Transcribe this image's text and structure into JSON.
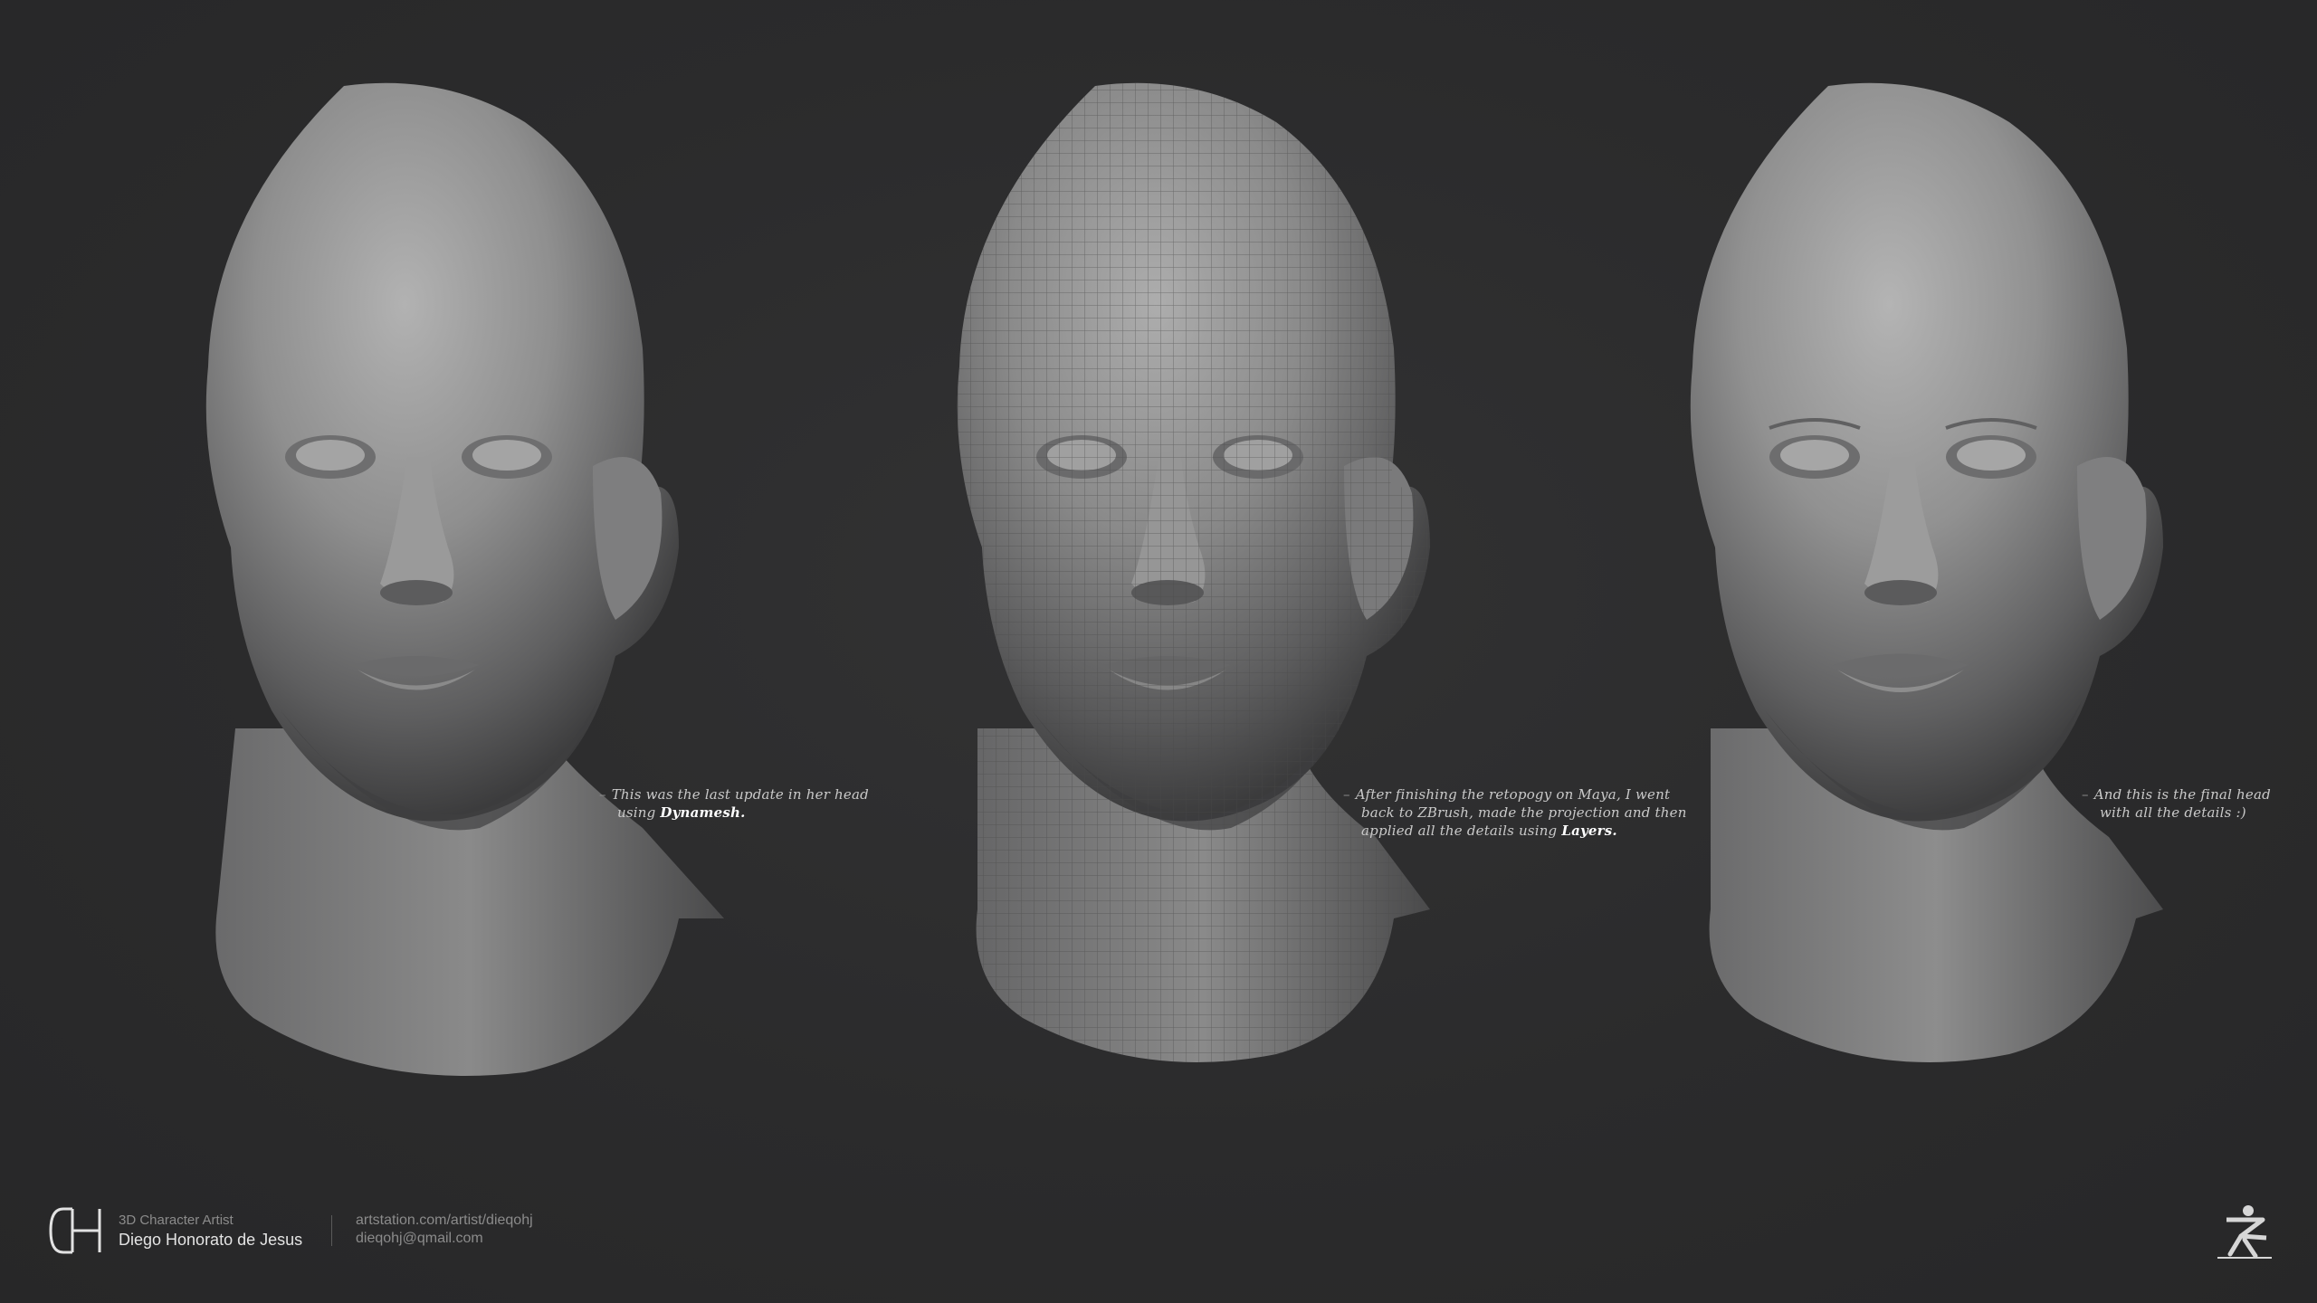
{
  "annotations": {
    "left": {
      "line1": "This was the last update in her head",
      "line2_prefix": "using ",
      "line2_emphasis": "Dynamesh."
    },
    "center": {
      "line1": "After finishing the retopogy on Maya, I went",
      "line2": "back to ZBrush, made the projection and then",
      "line3_prefix": "applied all the details using ",
      "line3_emphasis": "Layers."
    },
    "right": {
      "line1": "And this is the final head",
      "line2": "with all the details :)"
    }
  },
  "footer": {
    "role": "3D Character Artist",
    "name": "Diego Honorato de Jesus",
    "url": "artstation.com/artist/dieqohj",
    "email": "dieqohj@qmail.com"
  },
  "icons": {
    "logo": "dh-monogram-icon",
    "brand": "zbrush-logo-icon"
  },
  "colors": {
    "background": "#2b2b2c",
    "model_light": "#a6a6a6",
    "model_shadow": "#3a3a3b",
    "text": "#c9c9c9",
    "emphasis": "#ffffff"
  }
}
